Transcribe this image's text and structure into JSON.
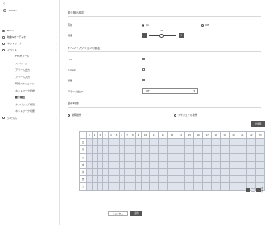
{
  "sidebar": {
    "back_icon": "chevron-left-icon",
    "user": "admin",
    "items": [
      {
        "label": "Basic",
        "icon": "grid-icon",
        "expandable": true
      },
      {
        "label": "映像&オーディオ",
        "icon": "camera-icon",
        "expandable": true
      },
      {
        "label": "ネットワーク",
        "icon": "network-icon",
        "expandable": true
      },
      {
        "label": "イベント",
        "icon": "bell-icon",
        "expandable": true
      }
    ],
    "subitems": [
      "FTP/Eメール",
      "ストレージ",
      "アラーム出力",
      "アラーム入力",
      "時間スケジュール",
      "ネットワーク断絶",
      "動き検出",
      "タンパリング検知",
      "ネットワーク切断"
    ],
    "active_subitem": "動き検出",
    "last_item": {
      "label": "システム",
      "icon": "gear-icon",
      "expandable": true
    }
  },
  "main": {
    "section1_title": "動き検出設定",
    "enable_label": "有効",
    "on_label": "On",
    "off_label": "Off",
    "sensitivity_label": "感度",
    "sensitivity_value": "75",
    "sensitivity_level": 75,
    "section2_title": "イベントアクションの設定",
    "ftp_label": "FTP",
    "email_label": "E-mail",
    "record_label": "録画",
    "alarm_out_label": "アラーム出力1",
    "alarm_out_value": "Off",
    "section3_title": "動作時間",
    "always_label": "常時動作",
    "schedule_label": "スケジュール動作",
    "clear_label": "全削除",
    "hours": [
      "0",
      "1",
      "2",
      "3",
      "4",
      "5",
      "6",
      "7",
      "8",
      "9",
      "10",
      "11",
      "12",
      "13",
      "14",
      "15",
      "16",
      "17",
      "18",
      "19",
      "20",
      "21",
      "22",
      "23"
    ],
    "days": [
      "日",
      "月",
      "火",
      "水",
      "木",
      "金",
      "土"
    ],
    "legend_label": "削除",
    "cancel_label": "キャンセル",
    "apply_label": "適用"
  },
  "colors": {
    "accent": "#555555",
    "grid_cell": "#dfe3ec",
    "grid_border": "#b5b9c4"
  }
}
